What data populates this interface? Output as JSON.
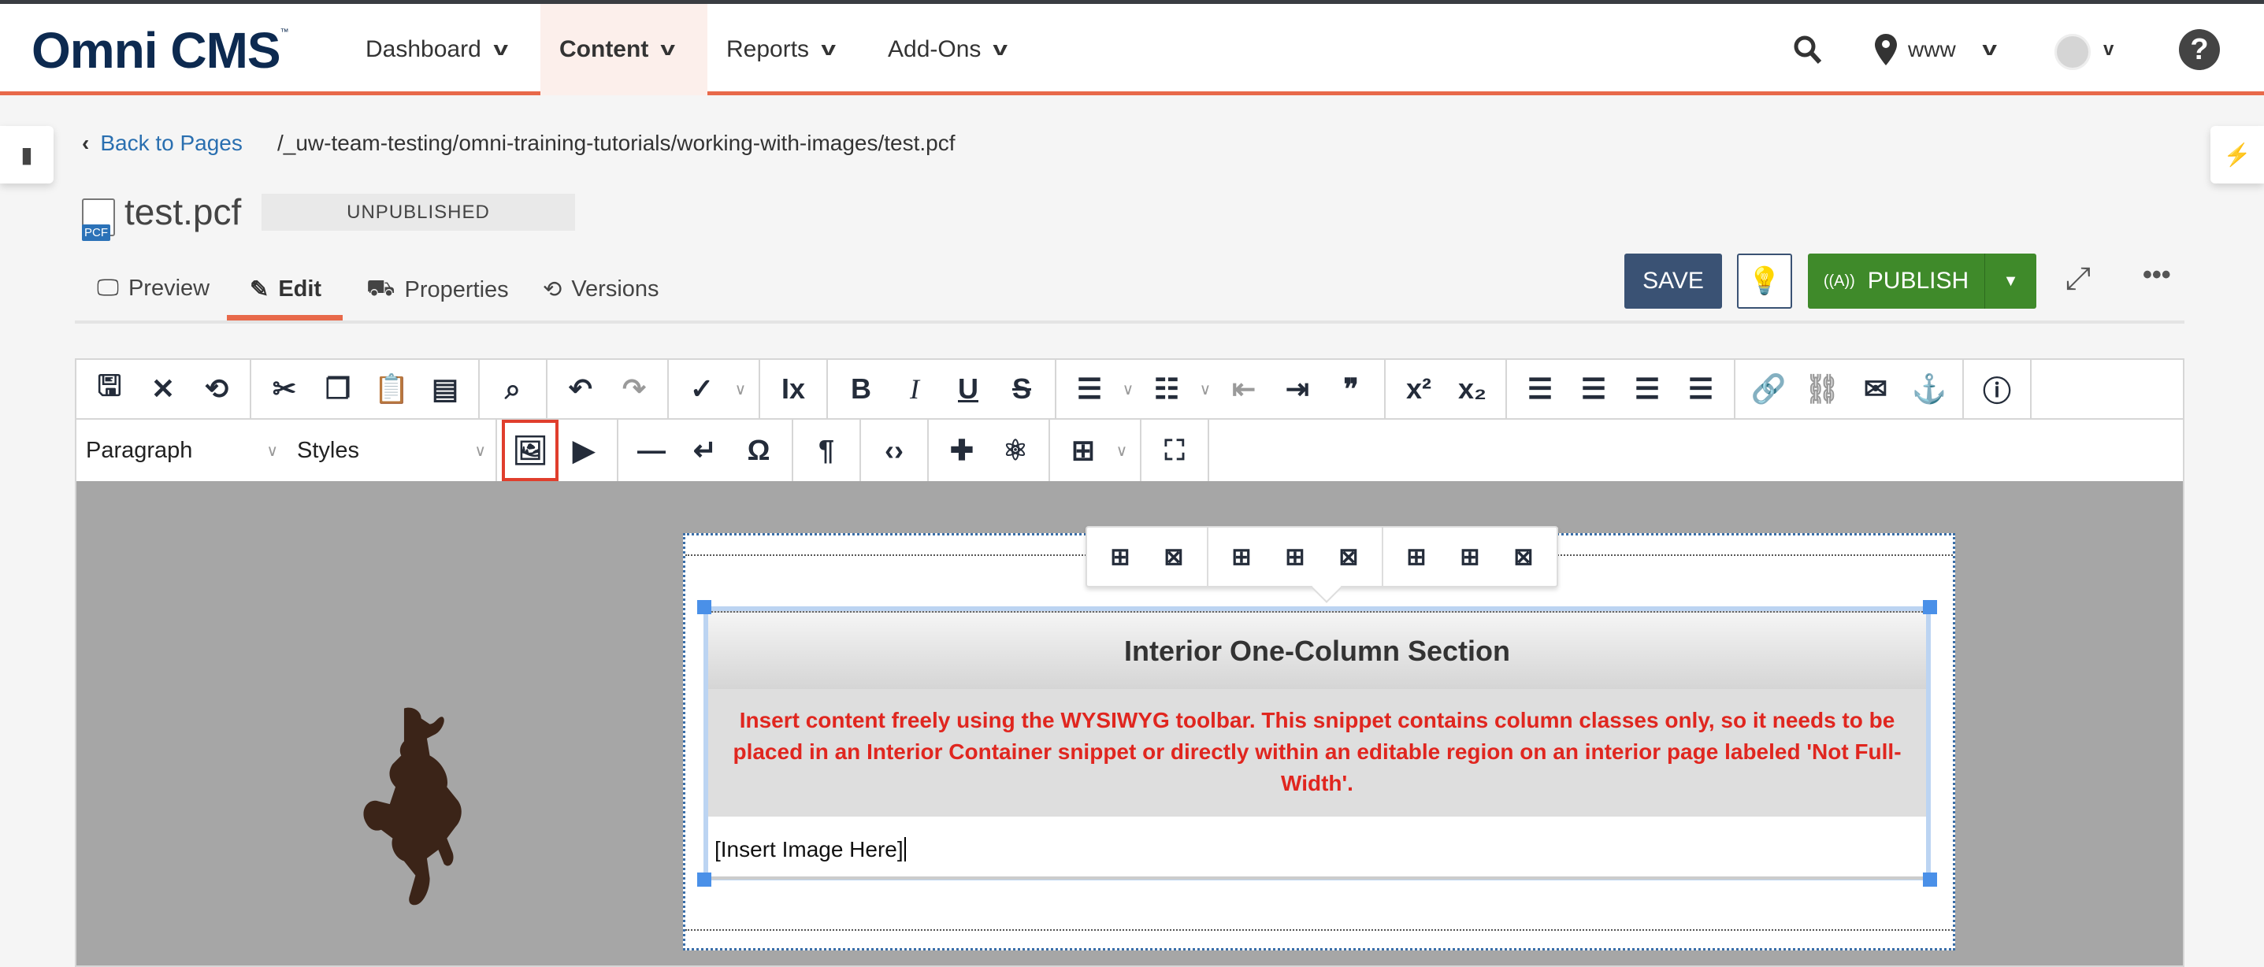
{
  "header": {
    "logo": "Omni CMS",
    "logo_tm": "™",
    "nav": [
      {
        "label": "Dashboard"
      },
      {
        "label": "Content",
        "active": true
      },
      {
        "label": "Reports"
      },
      {
        "label": "Add-Ons"
      }
    ],
    "site": "www",
    "help": "?"
  },
  "colors": {
    "accent": "#e8694a",
    "save": "#3a5274",
    "publish": "#3f8a2a",
    "note_text": "#e0261f",
    "logo": "#0d2a50"
  },
  "breadcrumb": {
    "back_label": "Back to Pages",
    "path": "/_uw-team-testing/omni-training-tutorials/working-with-images/test.pcf"
  },
  "file": {
    "icon_label": "PCF",
    "name": "test.pcf",
    "status": "UNPUBLISHED"
  },
  "tabs": [
    {
      "label": "Preview"
    },
    {
      "label": "Edit",
      "active": true
    },
    {
      "label": "Properties"
    },
    {
      "label": "Versions"
    }
  ],
  "actions": {
    "save": "SAVE",
    "publish": "PUBLISH"
  },
  "toolbar": {
    "row1": [
      [
        "save",
        "close",
        "restore-history"
      ],
      [
        "cut",
        "copy",
        "paste",
        "paste-text"
      ],
      [
        "find"
      ],
      [
        "undo",
        "redo-disabled"
      ],
      [
        "spellcheck",
        "dropdown"
      ],
      [
        "clear-formatting"
      ],
      [
        "bold",
        "italic",
        "underline",
        "strikethrough"
      ],
      [
        "bullet-list",
        "dropdown",
        "numbered-list",
        "dropdown",
        "outdent-disabled",
        "indent",
        "blockquote"
      ],
      [
        "superscript",
        "subscript"
      ],
      [
        "align-left",
        "align-center",
        "align-right",
        "align-justify"
      ],
      [
        "link",
        "unlink-disabled",
        "email",
        "anchor"
      ],
      [
        "help"
      ]
    ],
    "row2": [
      [
        "insert-image-highlighted",
        "insert-media"
      ],
      [
        "horizontal-rule",
        "line-break",
        "special-character"
      ],
      [
        "show-blocks"
      ],
      [
        "source-code"
      ],
      [
        "snippet",
        "component"
      ],
      [
        "table",
        "dropdown"
      ],
      [
        "fullscreen"
      ]
    ],
    "format_select": "Paragraph",
    "styles_select": "Styles"
  },
  "table_toolbar": [
    [
      "table-properties",
      "delete-table"
    ],
    [
      "insert-row-before",
      "insert-row-after",
      "delete-row"
    ],
    [
      "insert-column-before",
      "insert-column-after",
      "delete-column"
    ]
  ],
  "content": {
    "section_title": "Interior One-Column Section",
    "section_note": "Insert content freely using the WYSIWYG toolbar. This snippet contains column classes only, so it needs to be placed in an Interior Container snippet or directly within an editable region on an interior page labeled 'Not Full-Width'.",
    "body_text": "[Insert Image Here]"
  }
}
